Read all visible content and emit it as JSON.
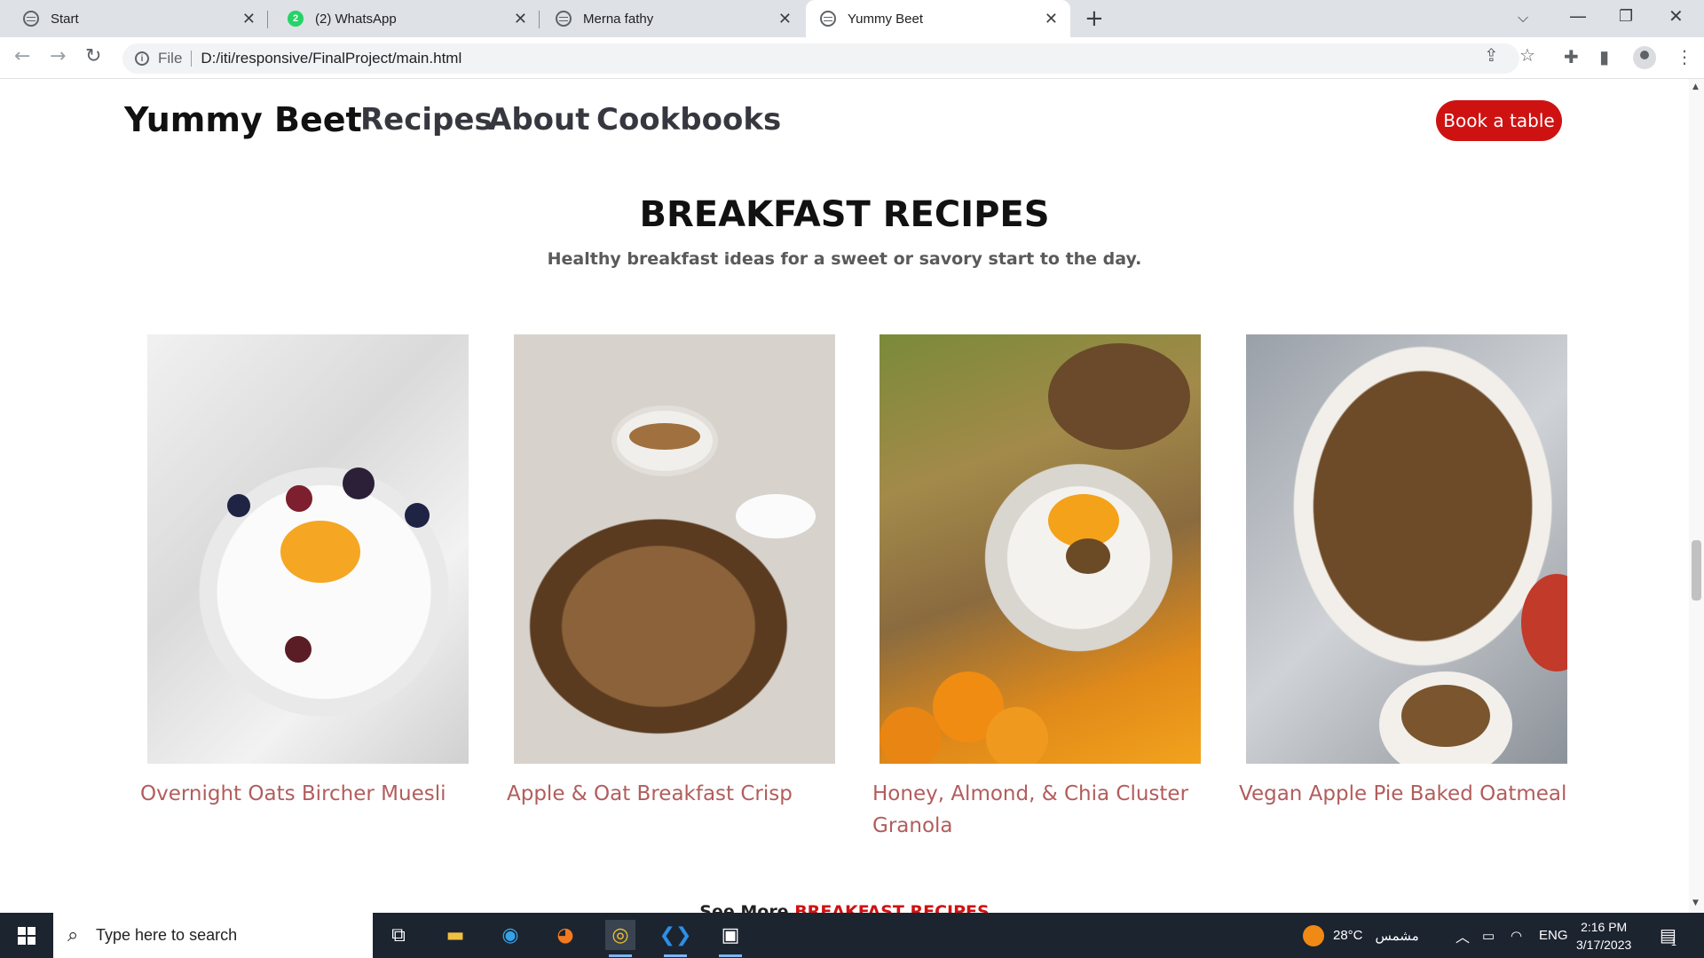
{
  "browser": {
    "tabs": [
      {
        "title": "Start",
        "icon": "globe-icon"
      },
      {
        "title": "(2) WhatsApp",
        "icon": "whatsapp-icon",
        "badge": "2"
      },
      {
        "title": "Merna fathy",
        "icon": "globe-icon"
      },
      {
        "title": "Yummy Beet",
        "icon": "globe-icon",
        "active": true
      }
    ],
    "address": {
      "scheme_label": "File",
      "url": "D:/iti/responsive/FinalProject/main.html"
    }
  },
  "site": {
    "brand": "Yummy Beet",
    "nav": [
      "Recipes",
      "About",
      "Cookbooks"
    ],
    "cta": "Book a table",
    "section_title": "BREAKFAST RECIPES",
    "section_subtitle": "Healthy breakfast ideas for a sweet or savory start to the day.",
    "recipes": [
      {
        "title": "Overnight Oats Bircher Muesli"
      },
      {
        "title": "Apple & Oat Breakfast Crisp"
      },
      {
        "title": "Honey, Almond, & Chia Cluster Granola"
      },
      {
        "title": "Vegan Apple Pie Baked Oatmeal"
      }
    ],
    "see_more_prefix": "See More",
    "see_more_link": "BREAKFAST RECIPES",
    "accent_color": "#ce1212",
    "recipe_title_color": "#b35c5c"
  },
  "taskbar": {
    "search_placeholder": "Type here to search",
    "weather_temp": "28°C",
    "weather_label": "مشمس",
    "language": "ENG",
    "time": "2:16 PM",
    "date": "3/17/2023",
    "notification_count": "1"
  }
}
